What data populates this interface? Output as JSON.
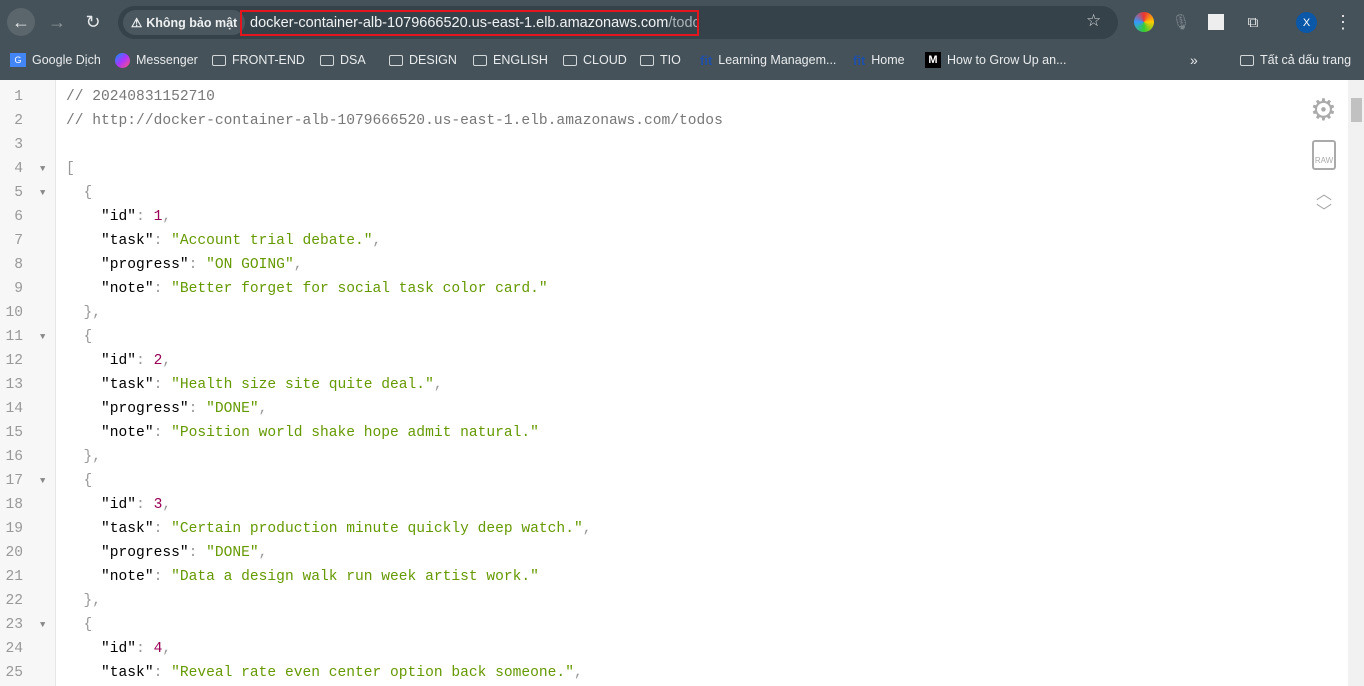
{
  "browser": {
    "security_label": "Không bảo mật",
    "url_host": "docker-container-alb-1079666520.us-east-1.elb.amazonaws.com",
    "url_path": "/todos",
    "profile_initial": "X",
    "bookmarks": [
      {
        "label": "Google Dịch",
        "icon": "google-translate-icon"
      },
      {
        "label": "Messenger",
        "icon": "messenger-icon"
      },
      {
        "label": "FRONT-END",
        "icon": "folder-icon"
      },
      {
        "label": "DSA",
        "icon": "folder-icon"
      },
      {
        "label": "DESIGN",
        "icon": "folder-icon"
      },
      {
        "label": "ENGLISH",
        "icon": "folder-icon"
      },
      {
        "label": "CLOUD",
        "icon": "folder-icon"
      },
      {
        "label": "TIO",
        "icon": "folder-icon"
      },
      {
        "label": "Learning Managem...",
        "icon": "fit-icon"
      },
      {
        "label": "Home",
        "icon": "fit-icon"
      },
      {
        "label": "How to Grow Up an...",
        "icon": "medium-icon"
      }
    ],
    "all_bookmarks_label": "Tất cả dấu trang"
  },
  "viewer": {
    "comments": [
      "// 20240831152710",
      "// http://docker-container-alb-1079666520.us-east-1.elb.amazonaws.com/todos"
    ],
    "raw_label": "RAW",
    "todos": [
      {
        "id": 1,
        "task": "Account trial debate.",
        "progress": "ON GOING",
        "note": "Better forget for social task color card."
      },
      {
        "id": 2,
        "task": "Health size site quite deal.",
        "progress": "DONE",
        "note": "Position world shake hope admit natural."
      },
      {
        "id": 3,
        "task": "Certain production minute quickly deep watch.",
        "progress": "DONE",
        "note": "Data a design walk run week artist work."
      },
      {
        "id": 4,
        "task": "Reveal rate even center option back someone."
      }
    ],
    "colors": {
      "string": "#669900",
      "number": "#990055",
      "comment": "#777777"
    }
  }
}
